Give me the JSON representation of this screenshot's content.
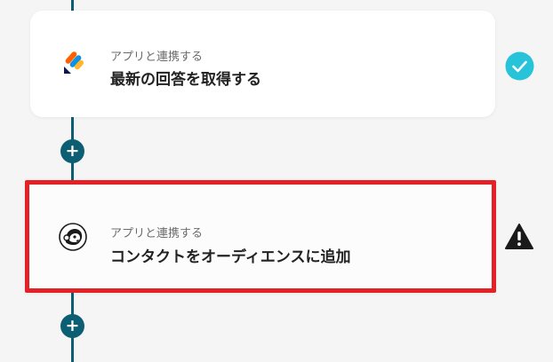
{
  "steps": [
    {
      "subtitle": "アプリと連携する",
      "title": "最新の回答を取得する",
      "status": "complete",
      "icon": "jotform-logo-icon"
    },
    {
      "subtitle": "アプリと連携する",
      "title": "コンタクトをオーディエンスに追加",
      "status": "warning",
      "icon": "mailchimp-logo-icon"
    }
  ],
  "add_button": {
    "label": "+"
  },
  "colors": {
    "flow_line": "#0c5f73",
    "check_badge": "#27c3d9",
    "highlight_border": "#e32126",
    "warning_icon": "#1a1a1a"
  }
}
